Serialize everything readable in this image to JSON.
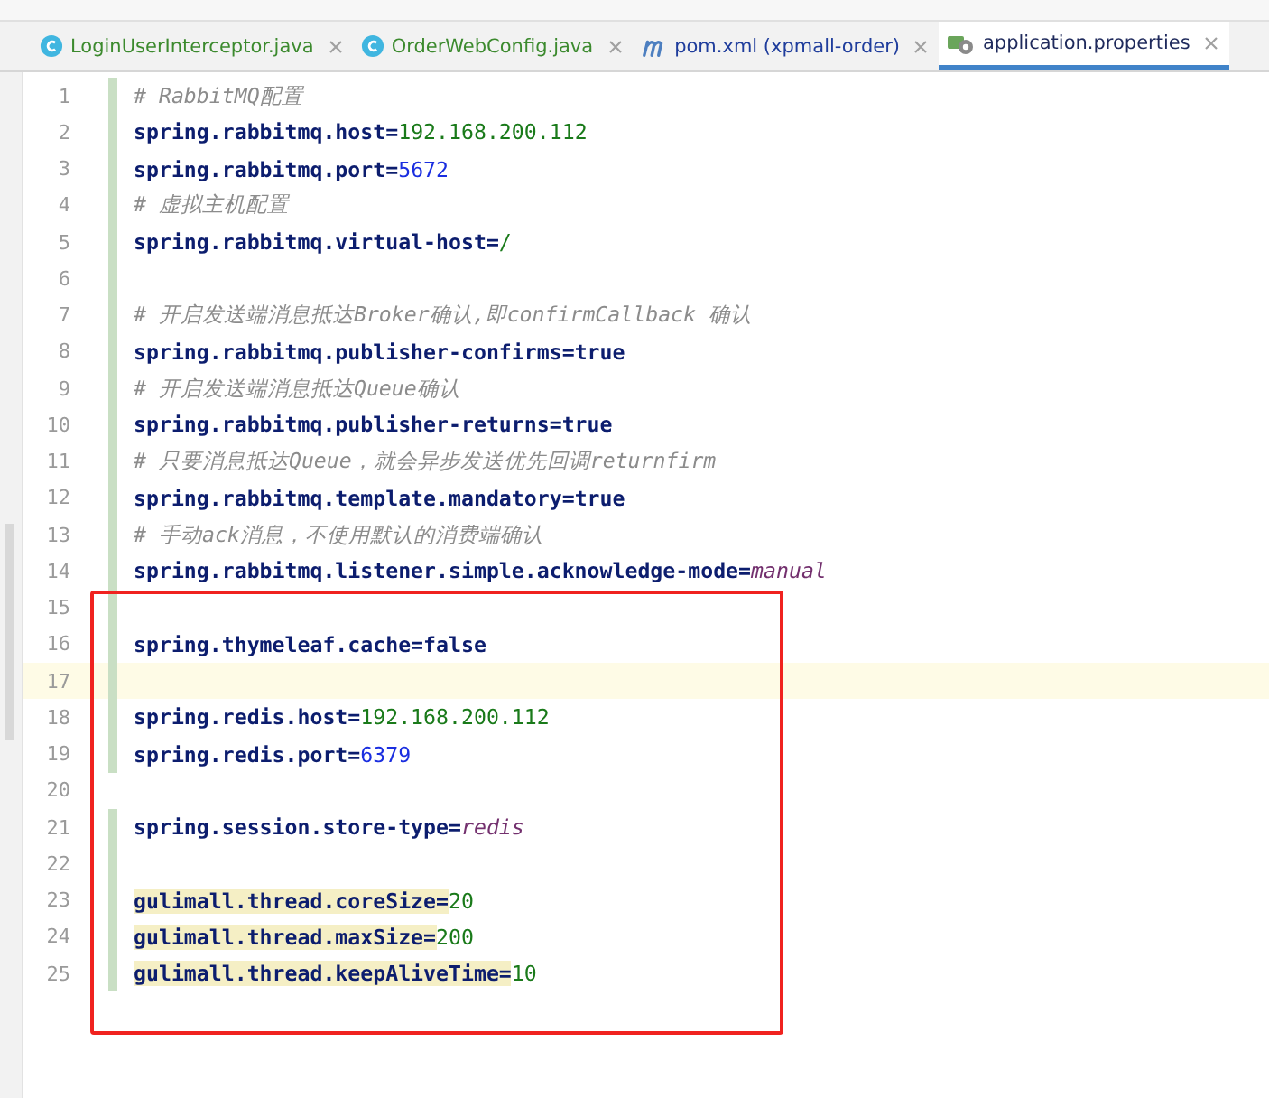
{
  "tabs": [
    {
      "label": "LoginUserInterceptor.java",
      "kind": "class",
      "color": "#3c8a2e",
      "selected": false
    },
    {
      "label": "OrderWebConfig.java",
      "kind": "class",
      "color": "#3c8a2e",
      "selected": false
    },
    {
      "label": "pom.xml (xpmall-order)",
      "kind": "maven",
      "color": "#1f3d9c",
      "selected": false
    },
    {
      "label": "application.properties",
      "kind": "properties",
      "color": "#1f2a5c",
      "selected": true
    }
  ],
  "lines": [
    {
      "number": "1",
      "kind": "comment",
      "text": "# RabbitMQ配置",
      "changed": true,
      "current": false
    },
    {
      "number": "2",
      "kind": "property",
      "key": "spring.rabbitmq.host=",
      "value": {
        "text": "192.168.200.112",
        "kind": "text"
      },
      "changed": true,
      "current": false,
      "highlighted": false
    },
    {
      "number": "3",
      "kind": "property",
      "key": "spring.rabbitmq.port=",
      "value": {
        "text": "5672",
        "kind": "number"
      },
      "changed": true,
      "current": false,
      "highlighted": false
    },
    {
      "number": "4",
      "kind": "comment",
      "text": "# 虚拟主机配置",
      "changed": true,
      "current": false
    },
    {
      "number": "5",
      "kind": "property",
      "key": "spring.rabbitmq.virtual-host=",
      "value": {
        "text": "/",
        "kind": "text"
      },
      "changed": true,
      "current": false,
      "highlighted": false
    },
    {
      "number": "6",
      "kind": "blank",
      "changed": true,
      "current": false
    },
    {
      "number": "7",
      "kind": "comment",
      "text": "# 开启发送端消息抵达Broker确认,即confirmCallback 确认",
      "changed": true,
      "current": false
    },
    {
      "number": "8",
      "kind": "property",
      "key": "spring.rabbitmq.publisher-confirms=",
      "value": {
        "text": "true",
        "kind": "keyword"
      },
      "changed": true,
      "current": false,
      "highlighted": false
    },
    {
      "number": "9",
      "kind": "comment",
      "text": "# 开启发送端消息抵达Queue确认",
      "changed": true,
      "current": false
    },
    {
      "number": "10",
      "kind": "property",
      "key": "spring.rabbitmq.publisher-returns=",
      "value": {
        "text": "true",
        "kind": "keyword"
      },
      "changed": true,
      "current": false,
      "highlighted": false
    },
    {
      "number": "11",
      "kind": "comment",
      "text": "# 只要消息抵达Queue，就会异步发送优先回调returnfirm",
      "changed": true,
      "current": false
    },
    {
      "number": "12",
      "kind": "property",
      "key": "spring.rabbitmq.template.mandatory=",
      "value": {
        "text": "true",
        "kind": "keyword"
      },
      "changed": true,
      "current": false,
      "highlighted": false
    },
    {
      "number": "13",
      "kind": "comment",
      "text": "# 手动ack消息，不使用默认的消费端确认",
      "changed": true,
      "current": false
    },
    {
      "number": "14",
      "kind": "property",
      "key": "spring.rabbitmq.listener.simple.acknowledge-mode=",
      "value": {
        "text": "manual",
        "kind": "enum"
      },
      "changed": true,
      "current": false,
      "highlighted": false
    },
    {
      "number": "15",
      "kind": "blank",
      "changed": true,
      "current": false
    },
    {
      "number": "16",
      "kind": "property",
      "key": "spring.thymeleaf.cache=",
      "value": {
        "text": "false",
        "kind": "keyword"
      },
      "changed": true,
      "current": false,
      "highlighted": false
    },
    {
      "number": "17",
      "kind": "blank",
      "changed": true,
      "current": true
    },
    {
      "number": "18",
      "kind": "property",
      "key": "spring.redis.host=",
      "value": {
        "text": "192.168.200.112",
        "kind": "text"
      },
      "changed": true,
      "current": false,
      "highlighted": false
    },
    {
      "number": "19",
      "kind": "property",
      "key": "spring.redis.port=",
      "value": {
        "text": "6379",
        "kind": "number"
      },
      "changed": true,
      "current": false,
      "highlighted": false
    },
    {
      "number": "20",
      "kind": "blank",
      "changed": false,
      "current": false
    },
    {
      "number": "21",
      "kind": "property",
      "key": "spring.session.store-type=",
      "value": {
        "text": "redis",
        "kind": "enum"
      },
      "changed": true,
      "current": false,
      "highlighted": false
    },
    {
      "number": "22",
      "kind": "blank",
      "changed": true,
      "current": false
    },
    {
      "number": "23",
      "kind": "property",
      "key": "gulimall.thread.coreSize=",
      "value": {
        "text": "20",
        "kind": "text"
      },
      "changed": true,
      "current": false,
      "highlighted": true
    },
    {
      "number": "24",
      "kind": "property",
      "key": "gulimall.thread.maxSize=",
      "value": {
        "text": "200",
        "kind": "text"
      },
      "changed": true,
      "current": false,
      "highlighted": true
    },
    {
      "number": "25",
      "kind": "property",
      "key": "gulimall.thread.keepAliveTime=",
      "value": {
        "text": "10",
        "kind": "text"
      },
      "changed": true,
      "current": false,
      "highlighted": true
    }
  ]
}
